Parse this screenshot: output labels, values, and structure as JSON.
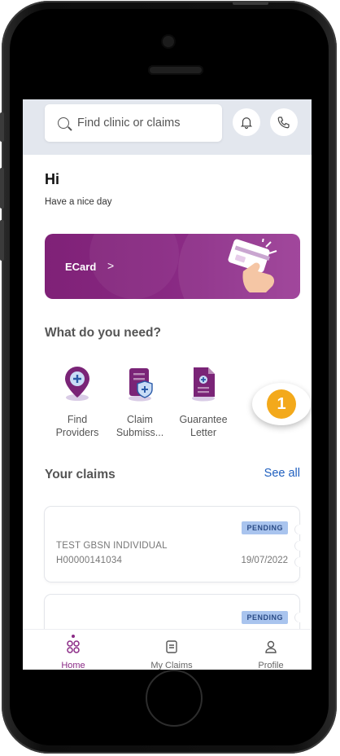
{
  "search": {
    "placeholder": "Find clinic or claims"
  },
  "greeting": {
    "title": "Hi",
    "subtitle": "Have a nice day"
  },
  "ecard": {
    "label": "ECard",
    "chevron": ">"
  },
  "services": {
    "title": "What do you need?",
    "items": [
      {
        "line1": "Find",
        "line2": "Providers",
        "icon": "find-providers-icon"
      },
      {
        "line1": "Claim",
        "line2": "Submiss...",
        "icon": "claim-submission-icon"
      },
      {
        "line1": "Guarantee",
        "line2": "Letter",
        "icon": "guarantee-letter-icon"
      }
    ]
  },
  "claims": {
    "title": "Your claims",
    "see_all": "See all",
    "items": [
      {
        "status": "PENDING",
        "name": "TEST GBSN INDIVIDUAL",
        "id": "H00000141034",
        "date": "19/07/2022"
      },
      {
        "status": "PENDING",
        "name": "",
        "id": "",
        "date": ""
      }
    ]
  },
  "nav": {
    "items": [
      {
        "label": "Home",
        "icon": "home-grid-icon",
        "active": true
      },
      {
        "label": "My Claims",
        "icon": "claims-doc-icon",
        "active": false
      },
      {
        "label": "Profile",
        "icon": "profile-icon",
        "active": false
      }
    ]
  },
  "tutorial": {
    "step": "1"
  },
  "colors": {
    "brand": "#8b2b86",
    "accent_link": "#1f5fbf",
    "badge_bg": "#a9c4ee",
    "step": "#f3a91b",
    "header_bg": "#e3e7ee"
  }
}
